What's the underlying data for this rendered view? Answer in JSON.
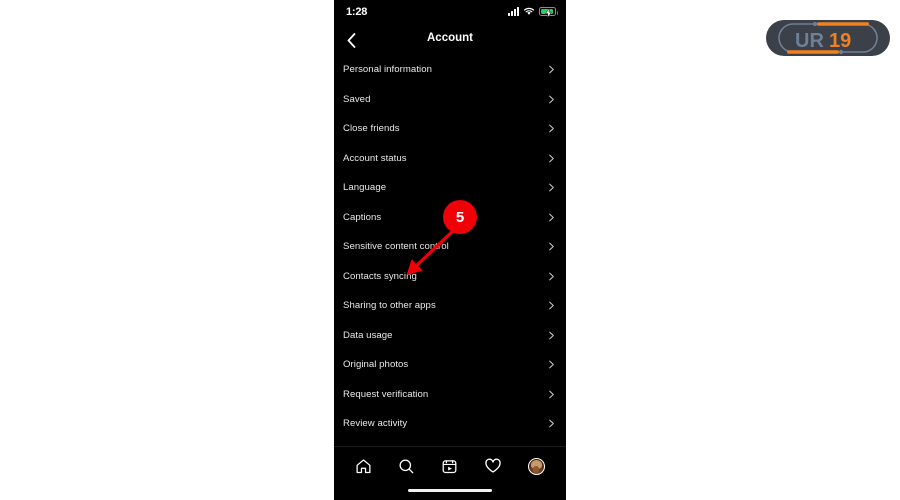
{
  "status_bar": {
    "time": "1:28",
    "signal_icon": "cellular-signal-icon",
    "wifi_icon": "wifi-icon",
    "battery_icon": "battery-charging-icon",
    "battery_color": "#2ad154"
  },
  "header": {
    "back_icon": "back-chevron-icon",
    "title": "Account"
  },
  "menu": {
    "items": [
      {
        "label": "Personal information",
        "chevron": "chevron-right-icon"
      },
      {
        "label": "Saved",
        "chevron": "chevron-right-icon"
      },
      {
        "label": "Close friends",
        "chevron": "chevron-right-icon"
      },
      {
        "label": "Account status",
        "chevron": "chevron-right-icon"
      },
      {
        "label": "Language",
        "chevron": "chevron-right-icon"
      },
      {
        "label": "Captions",
        "chevron": "chevron-right-icon"
      },
      {
        "label": "Sensitive content control",
        "chevron": "chevron-right-icon"
      },
      {
        "label": "Contacts syncing",
        "chevron": "chevron-right-icon"
      },
      {
        "label": "Sharing to other apps",
        "chevron": "chevron-right-icon"
      },
      {
        "label": "Data usage",
        "chevron": "chevron-right-icon"
      },
      {
        "label": "Original photos",
        "chevron": "chevron-right-icon"
      },
      {
        "label": "Request verification",
        "chevron": "chevron-right-icon"
      },
      {
        "label": "Review activity",
        "chevron": "chevron-right-icon"
      }
    ]
  },
  "bottom_nav": {
    "items": [
      {
        "icon": "home-icon"
      },
      {
        "icon": "search-icon"
      },
      {
        "icon": "reels-icon"
      },
      {
        "icon": "heart-icon"
      },
      {
        "icon": "profile-avatar"
      }
    ]
  },
  "annotation": {
    "step_number": "5",
    "badge_color": "#f00007",
    "arrow_icon": "arrow-pointer-icon",
    "points_to": "Contacts syncing"
  },
  "brand_logo": {
    "text": "UR19",
    "orange": "#f08020",
    "slate": "#6f7f96",
    "pill": "#3b4049"
  }
}
